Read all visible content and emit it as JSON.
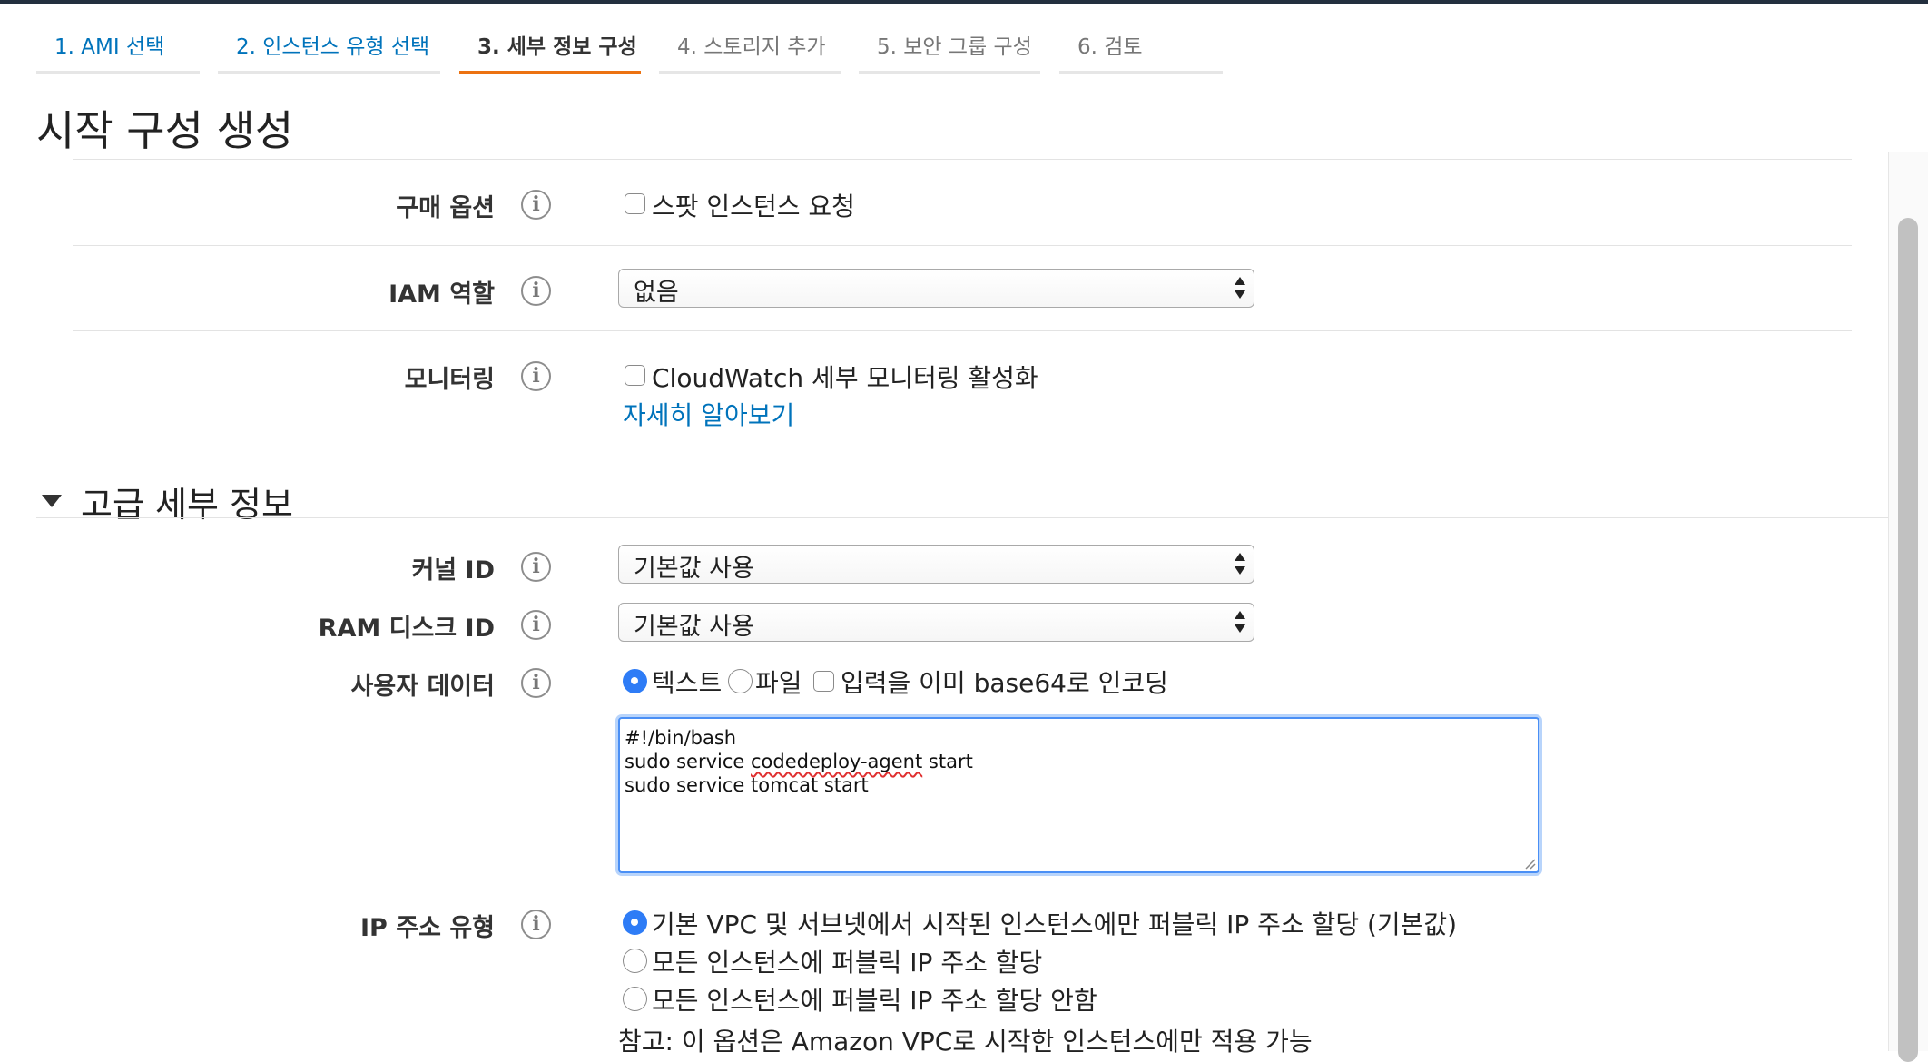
{
  "tabs": [
    {
      "label": "1. AMI 선택",
      "state": "done"
    },
    {
      "label": "2. 인스턴스 유형 선택",
      "state": "done"
    },
    {
      "label": "3. 세부 정보 구성",
      "state": "active"
    },
    {
      "label": "4. 스토리지 추가",
      "state": "future"
    },
    {
      "label": "5. 보안 그룹 구성",
      "state": "future"
    },
    {
      "label": "6. 검토",
      "state": "future"
    }
  ],
  "page_title": "시작 구성 생성",
  "info_glyph": "i",
  "purchase": {
    "label": "구매 옵션",
    "spot_label": "스팟 인스턴스 요청",
    "spot_checked": false
  },
  "iam": {
    "label": "IAM 역할",
    "value": "없음"
  },
  "monitoring": {
    "label": "모니터링",
    "cloudwatch_label": "CloudWatch 세부 모니터링 활성화",
    "cloudwatch_checked": false,
    "learn_more": "자세히 알아보기"
  },
  "advanced": {
    "title": "고급 세부 정보"
  },
  "kernel": {
    "label": "커널 ID",
    "value": "기본값 사용"
  },
  "ramdisk": {
    "label": "RAM 디스크 ID",
    "value": "기본값 사용"
  },
  "userdata": {
    "label": "사용자 데이터",
    "text_option": "텍스트",
    "file_option": "파일",
    "base64_option": "입력을 이미 base64로 인코딩",
    "selected": "텍스트",
    "base64_checked": false,
    "line1": "#!/bin/bash",
    "line2_a": "sudo service ",
    "line2_b": "codedeploy-agent",
    "line2_c": " start",
    "line3": "sudo service tomcat start"
  },
  "ip": {
    "label": "IP 주소 유형",
    "option1": "기본 VPC 및 서브넷에서 시작된 인스턴스에만 퍼블릭 IP 주소 할당 (기본값)",
    "option2": "모든 인스턴스에 퍼블릭 IP 주소 할당",
    "option3": "모든 인스턴스에 퍼블릭 IP 주소 할당 안함",
    "selected": 1,
    "note": "참고: 이 옵션은 Amazon VPC로 시작한 인스턴스에만 적용 가능"
  },
  "colors": {
    "accent": "#ec7211",
    "link": "#0073bb",
    "radio": "#2e7cf6",
    "focus": "#4a8ff5"
  }
}
